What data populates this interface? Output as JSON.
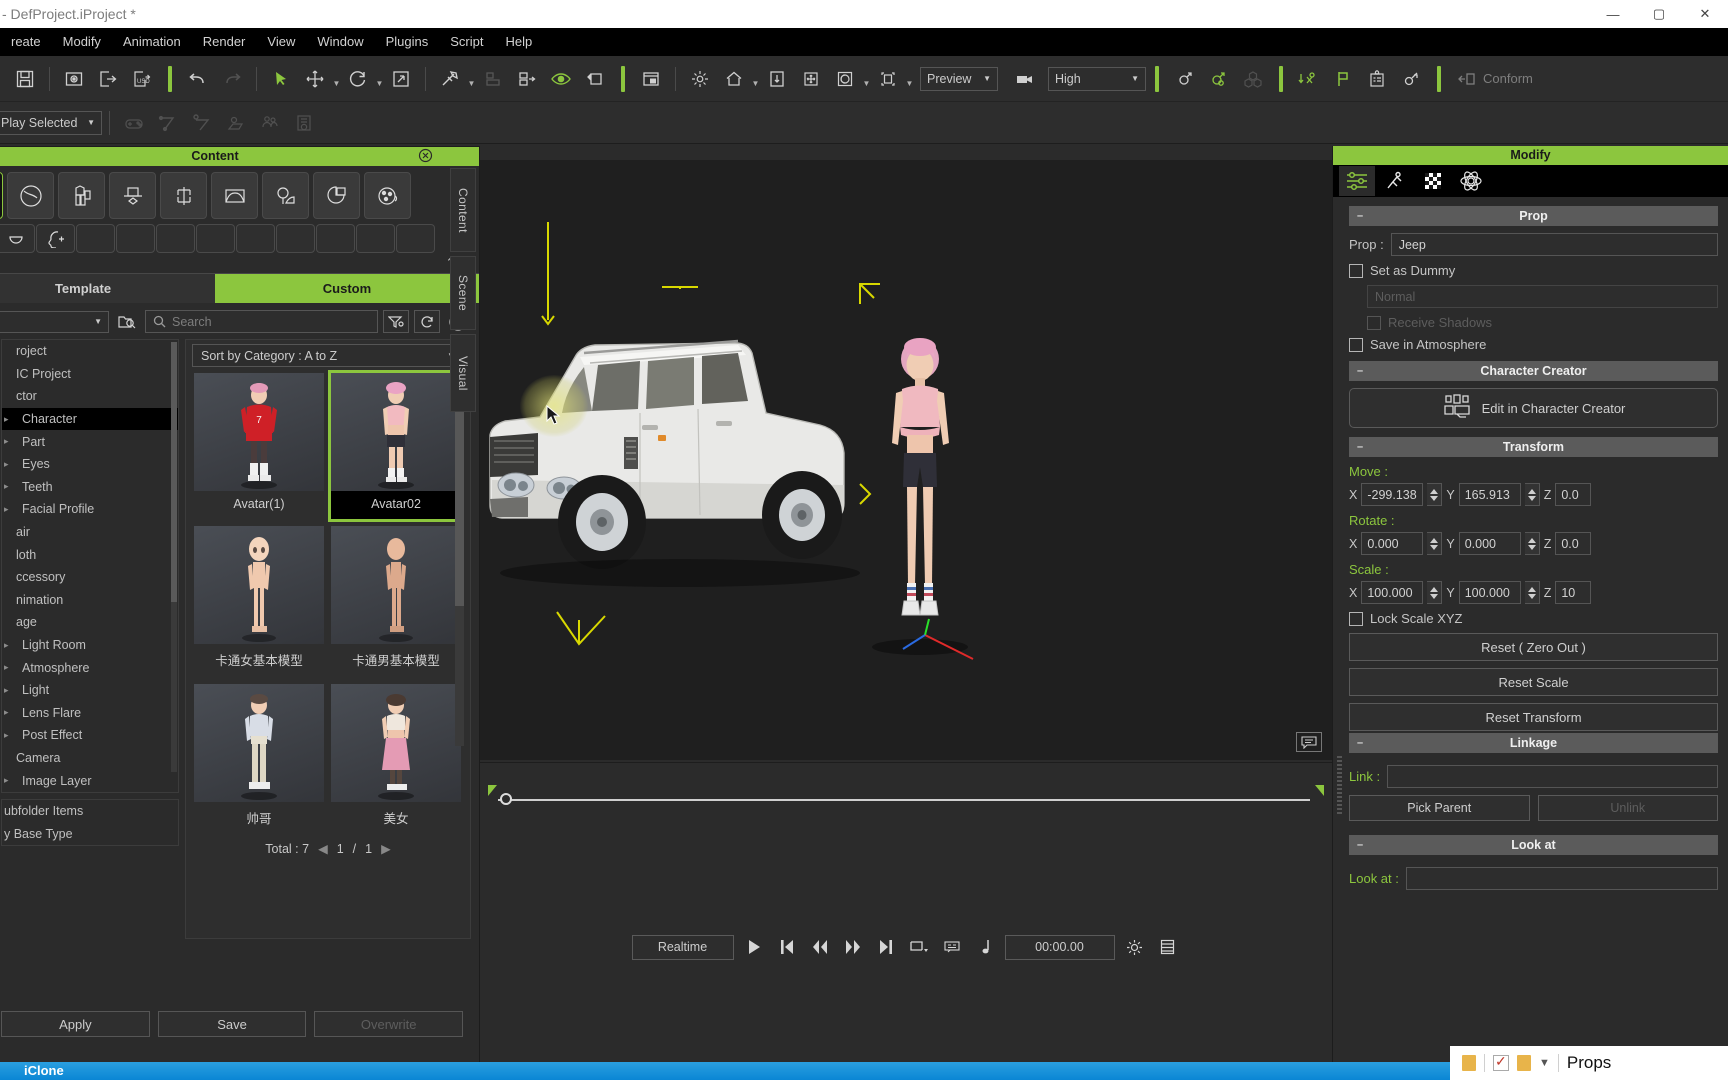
{
  "window": {
    "title": "- DefProject.iProject *",
    "minimize": "—",
    "maximize": "▢",
    "close": "✕"
  },
  "menu": {
    "items": [
      "reate",
      "Modify",
      "Animation",
      "Render",
      "View",
      "Window",
      "Plugins",
      "Script",
      "Help"
    ]
  },
  "toolbar": {
    "preview_quality_mode": "Preview",
    "render_quality": "High",
    "conform_label": "Conform",
    "icons": [
      "save-icon",
      "project-preview-icon",
      "export-icon",
      "usd-export-icon",
      "undo-icon",
      "redo-icon",
      "select-tool-icon",
      "move-tool-icon",
      "rotate-tool-icon",
      "scale-tool-icon",
      "link-tool-icon",
      "align-icon",
      "align-distribute-icon",
      "eye-visibility-icon",
      "snap-icon",
      "window-layout-icon",
      "light-icon",
      "home-view-icon",
      "ground-icon",
      "center-icon",
      "render-mode-icon",
      "frame-selection-icon",
      "camera-icon",
      "gender-icon",
      "gender-edit-icon",
      "cube-group-icon",
      "physics-drop-icon",
      "flag-icon",
      "checklist-icon",
      "key-add-icon",
      "conform-icon"
    ]
  },
  "toolbar2": {
    "play_mode": "Play Selected",
    "icons": [
      "gamepad-icon",
      "path-icon",
      "path-key-icon",
      "motion-area-icon",
      "crowd-icon",
      "media-list-icon"
    ]
  },
  "content_panel": {
    "title": "Content",
    "close_icon": "close-icon",
    "category_icons": [
      "avatar-icon",
      "hair-icon",
      "cloth-icon",
      "accessory-icon",
      "prop-icon",
      "stage-icon",
      "tree-scene-icon",
      "media-icon",
      "particle-icon"
    ],
    "sub_icons": [
      "eye-icon",
      "lens-icon",
      "head-add-icon"
    ],
    "collapse_icon": "chevron-up-icon",
    "tabs": [
      {
        "label": "Template",
        "active": false
      },
      {
        "label": "Custom",
        "active": true
      }
    ],
    "filter": {
      "folder_combo": "",
      "folder_search_icon": "folder-search-icon",
      "search_placeholder": "Search",
      "search_icon": "search-icon",
      "filter_icon": "filter-icon",
      "refresh_icon": "refresh-icon",
      "expand_icon": "chevron-down-circle-icon"
    },
    "sort": "Sort by Category : A to Z",
    "tree": [
      {
        "label": "roject",
        "indent": 0,
        "selected": false,
        "twisty": ""
      },
      {
        "label": "IC Project",
        "indent": 0,
        "selected": false,
        "twisty": ""
      },
      {
        "label": "ctor",
        "indent": 0,
        "selected": false,
        "twisty": ""
      },
      {
        "label": "Character",
        "indent": 1,
        "selected": true,
        "twisty": ""
      },
      {
        "label": "Part",
        "indent": 1,
        "selected": false,
        "twisty": ""
      },
      {
        "label": "Eyes",
        "indent": 1,
        "selected": false,
        "twisty": ""
      },
      {
        "label": "Teeth",
        "indent": 1,
        "selected": false,
        "twisty": ""
      },
      {
        "label": "Facial Profile",
        "indent": 1,
        "selected": false,
        "twisty": ""
      },
      {
        "label": "air",
        "indent": 0,
        "selected": false,
        "twisty": ""
      },
      {
        "label": "loth",
        "indent": 0,
        "selected": false,
        "twisty": ""
      },
      {
        "label": "ccessory",
        "indent": 0,
        "selected": false,
        "twisty": ""
      },
      {
        "label": "nimation",
        "indent": 0,
        "selected": false,
        "twisty": ""
      },
      {
        "label": "age",
        "indent": 0,
        "selected": false,
        "twisty": ""
      },
      {
        "label": "Light Room",
        "indent": 1,
        "selected": false,
        "twisty": ""
      },
      {
        "label": "Atmosphere",
        "indent": 1,
        "selected": false,
        "twisty": ""
      },
      {
        "label": "Light",
        "indent": 1,
        "selected": false,
        "twisty": ""
      },
      {
        "label": "Lens Flare",
        "indent": 1,
        "selected": false,
        "twisty": ""
      },
      {
        "label": "Post Effect",
        "indent": 1,
        "selected": false,
        "twisty": ""
      },
      {
        "label": "Camera",
        "indent": 0,
        "selected": false,
        "twisty": ""
      },
      {
        "label": "Image Layer",
        "indent": 1,
        "selected": false,
        "twisty": ""
      }
    ],
    "tree2": [
      {
        "label": "ubfolder Items"
      },
      {
        "label": "y Base Type"
      }
    ],
    "items": [
      {
        "name": "Avatar(1)",
        "selected": false,
        "variant": "red"
      },
      {
        "name": "Avatar02",
        "selected": true,
        "variant": "pink"
      },
      {
        "name": "卡通女基本模型",
        "selected": false,
        "variant": "toon-f"
      },
      {
        "name": "卡通男基本模型",
        "selected": false,
        "variant": "toon-m"
      },
      {
        "name": "帅哥",
        "selected": false,
        "variant": "guy"
      },
      {
        "name": "美女",
        "selected": false,
        "variant": "girl"
      }
    ],
    "total_label": "Total : 7",
    "page_current": "1",
    "page_sep": "/",
    "page_total": "1",
    "prev_icon": "chevron-left-icon",
    "next_icon": "chevron-right-icon",
    "buttons": {
      "apply": "Apply",
      "save": "Save",
      "overwrite": "Overwrite"
    }
  },
  "dock_tabs": [
    "Content",
    "Scene",
    "Visual"
  ],
  "viewport": {
    "note_icon": "note-icon",
    "objects": [
      "jeep-prop",
      "avatar-character"
    ]
  },
  "timeline": {
    "mode": "Realtime",
    "timecode": "00:00.00",
    "buttons": [
      "play-icon",
      "go-to-start-icon",
      "step-back-icon",
      "step-forward-icon",
      "go-to-end-icon",
      "range-icon",
      "subtitle-icon",
      "audio-icon"
    ],
    "settings_icon": "gear-icon",
    "list_icon": "list-icon"
  },
  "modify_panel": {
    "title": "Modify",
    "tabs": [
      "sliders-icon",
      "motion-icon",
      "material-icon",
      "physics-icon"
    ],
    "prop_section": {
      "header": "Prop",
      "prop_label": "Prop :",
      "prop_value": "Jeep",
      "set_as_dummy": "Set as Dummy",
      "normal_value": "Normal",
      "receive_shadows": "Receive Shadows",
      "save_in_atmosphere": "Save in Atmosphere"
    },
    "character_creator": {
      "header": "Character Creator",
      "edit_button": "Edit in Character Creator",
      "edit_icon": "character-creator-icon"
    },
    "transform": {
      "header": "Transform",
      "move_label": "Move :",
      "move": {
        "x": "-299.138",
        "y": "165.913",
        "z": "0.0"
      },
      "rotate_label": "Rotate :",
      "rotate": {
        "x": "0.000",
        "y": "0.000",
        "z": "0.0"
      },
      "scale_label": "Scale :",
      "scale": {
        "x": "100.000",
        "y": "100.000",
        "z": "10"
      },
      "axis_x": "X",
      "axis_y": "Y",
      "axis_z": "Z",
      "lock_scale": "Lock Scale XYZ",
      "reset_zero_out": "Reset ( Zero Out )",
      "reset_scale": "Reset Scale",
      "reset_transform": "Reset Transform"
    },
    "linkage": {
      "header": "Linkage",
      "link_label": "Link :",
      "link_value": "",
      "pick_parent": "Pick Parent",
      "unlink": "Unlink"
    },
    "look_at": {
      "header": "Look at",
      "label": "Look at :",
      "value": ""
    }
  },
  "explorer": {
    "label": "Props",
    "icons": [
      "folder-icon",
      "checklist-icon",
      "folder-icon",
      "dropdown-icon"
    ]
  },
  "taskbar": {
    "label": "iClone"
  },
  "colors": {
    "accent_green": "#8cc63e",
    "panel_bg": "#2b2b2b",
    "toolbar_bg": "#2d2d2d",
    "section_bg": "#5b5b5b",
    "taskbar_blue": "#0a86d4"
  }
}
